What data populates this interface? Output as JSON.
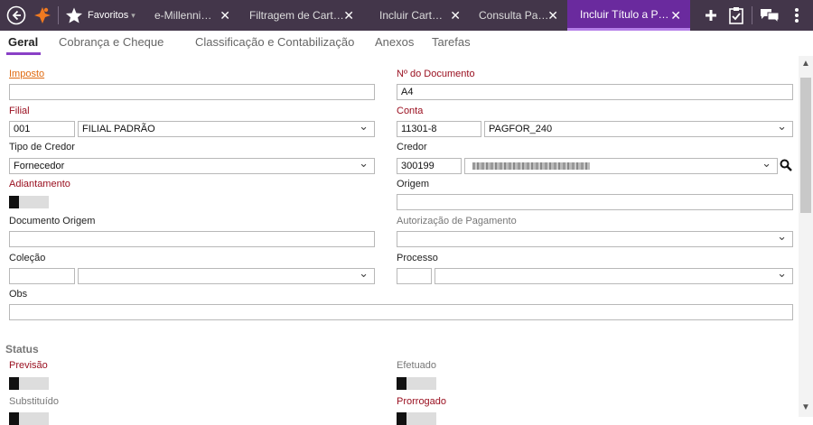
{
  "topbar": {
    "favorites_label": "Favoritos",
    "favorites_caret": "▾",
    "tabs": [
      {
        "label": "e-Millenni…"
      },
      {
        "label": "Filtragem de Cart…"
      },
      {
        "label": "Incluir Cart…"
      },
      {
        "label": "Consulta Pa…"
      },
      {
        "label": "Incluir Título a P…"
      }
    ],
    "close_glyph": "✕",
    "icons": [
      "back-icon",
      "app-logo-icon",
      "star-icon",
      "plus-icon",
      "clipboard-check-icon",
      "chat-icon",
      "more-vert-icon"
    ]
  },
  "subtabs": [
    "Geral",
    "Cobrança e Cheque",
    "Classificação e Contabilização",
    "Anexos",
    "Tarefas"
  ],
  "form": {
    "imposto": {
      "label": "Imposto",
      "value": ""
    },
    "numero_documento": {
      "label": "Nº do Documento",
      "value": "A4"
    },
    "filial": {
      "label": "Filial",
      "code": "001",
      "name": "FILIAL PADRÃO"
    },
    "conta": {
      "label": "Conta",
      "code": "11301-8",
      "name": "PAGFOR_240"
    },
    "tipo_credor": {
      "label": "Tipo de Credor",
      "value": "Fornecedor"
    },
    "credor": {
      "label": "Credor",
      "code": "300199",
      "name": ""
    },
    "adiantamento": {
      "label": "Adiantamento",
      "on": false
    },
    "origem": {
      "label": "Origem",
      "value": ""
    },
    "documento_origem": {
      "label": "Documento Origem",
      "value": ""
    },
    "autorizacao_pagamento": {
      "label": "Autorização de Pagamento",
      "value": ""
    },
    "colecao": {
      "label": "Coleção",
      "code": "",
      "name": ""
    },
    "processo": {
      "label": "Processo",
      "code": "",
      "name": ""
    },
    "obs": {
      "label": "Obs",
      "value": ""
    }
  },
  "status": {
    "title": "Status",
    "previsao": {
      "label": "Previsão",
      "on": false
    },
    "efetuado": {
      "label": "Efetuado",
      "on": false
    },
    "substituido": {
      "label": "Substituído",
      "on": false
    },
    "prorrogado": {
      "label": "Prorrogado",
      "on": false
    }
  },
  "colors": {
    "topbar": "#43364a",
    "active_tab": "#6a2a9e",
    "required_label": "#9a1020",
    "link_label": "#e06a10"
  }
}
